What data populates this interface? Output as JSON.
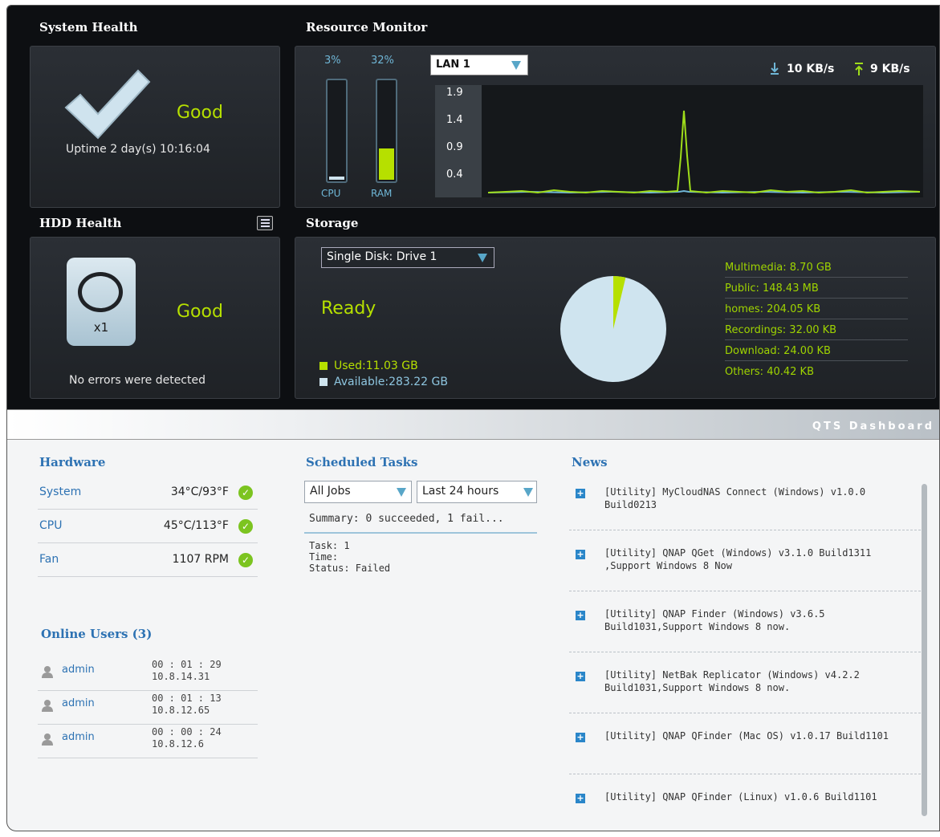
{
  "system_health": {
    "title": "System Health",
    "status": "Good",
    "uptime": "Uptime 2 day(s) 10:16:04"
  },
  "resource_monitor": {
    "title": "Resource Monitor",
    "cpu": {
      "percent_label": "3%",
      "label": "CPU",
      "value": 3
    },
    "ram": {
      "percent_label": "32%",
      "label": "RAM",
      "value": 32
    },
    "network_select": "LAN 1",
    "download": "10 KB/s",
    "upload": "9 KB/s",
    "y_ticks": [
      "1.9",
      "1.4",
      "0.9",
      "0.4"
    ],
    "colors": {
      "download": "#9fdd1a",
      "upload": "#6fb6d6"
    }
  },
  "hdd_health": {
    "title": "HDD Health",
    "status": "Good",
    "count": "x1",
    "message": "No errors were detected"
  },
  "storage": {
    "title": "Storage",
    "disk_select": "Single Disk: Drive  1",
    "status": "Ready",
    "used": "Used:11.03 GB",
    "available": "Available:283.22 GB",
    "used_fraction": 0.0375,
    "shares": [
      "Multimedia: 8.70 GB",
      "Public: 148.43 MB",
      "homes: 204.05 KB",
      "Recordings: 32.00 KB",
      "Download: 24.00 KB",
      "Others: 40.42 KB"
    ],
    "colors": {
      "used": "#b6e000",
      "available": "#cfe4ef"
    }
  },
  "banner": {
    "text": "QTS  Dashboard"
  },
  "hardware": {
    "title": "Hardware",
    "rows": [
      {
        "name": "System",
        "value": "34°C/93°F"
      },
      {
        "name": "CPU",
        "value": "45°C/113°F"
      },
      {
        "name": "Fan",
        "value": "1107 RPM"
      }
    ]
  },
  "online_users": {
    "title": "Online Users (3)",
    "users": [
      {
        "name": "admin",
        "time": "00 : 01 : 29",
        "ip": "10.8.14.31"
      },
      {
        "name": "admin",
        "time": "00 : 01 : 13",
        "ip": "10.8.12.65"
      },
      {
        "name": "admin",
        "time": "00 : 00 : 24",
        "ip": "10.8.12.6"
      }
    ]
  },
  "scheduled_tasks": {
    "title": "Scheduled Tasks",
    "job_filter": "All Jobs",
    "time_filter": "Last 24 hours",
    "summary": "Summary: 0 succeeded, 1 fail...",
    "task": "Task: 1",
    "time": "Time:",
    "status": "Status: Failed"
  },
  "news": {
    "title": "News",
    "items": [
      "[Utility] MyCloudNAS Connect (Windows) v1.0.0 Build0213",
      "[Utility] QNAP QGet (Windows) v3.1.0 Build1311 ,Support Windows 8 Now",
      "[Utility] QNAP Finder (Windows) v3.6.5 Build1031,Support Windows 8 now.",
      "[Utility] NetBak Replicator (Windows) v4.2.2 Build1031,Support Windows 8 now.",
      "[Utility] QNAP QFinder (Mac OS) v1.0.17 Build1101",
      "[Utility] QNAP QFinder (Linux) v1.0.6 Build1101"
    ]
  }
}
